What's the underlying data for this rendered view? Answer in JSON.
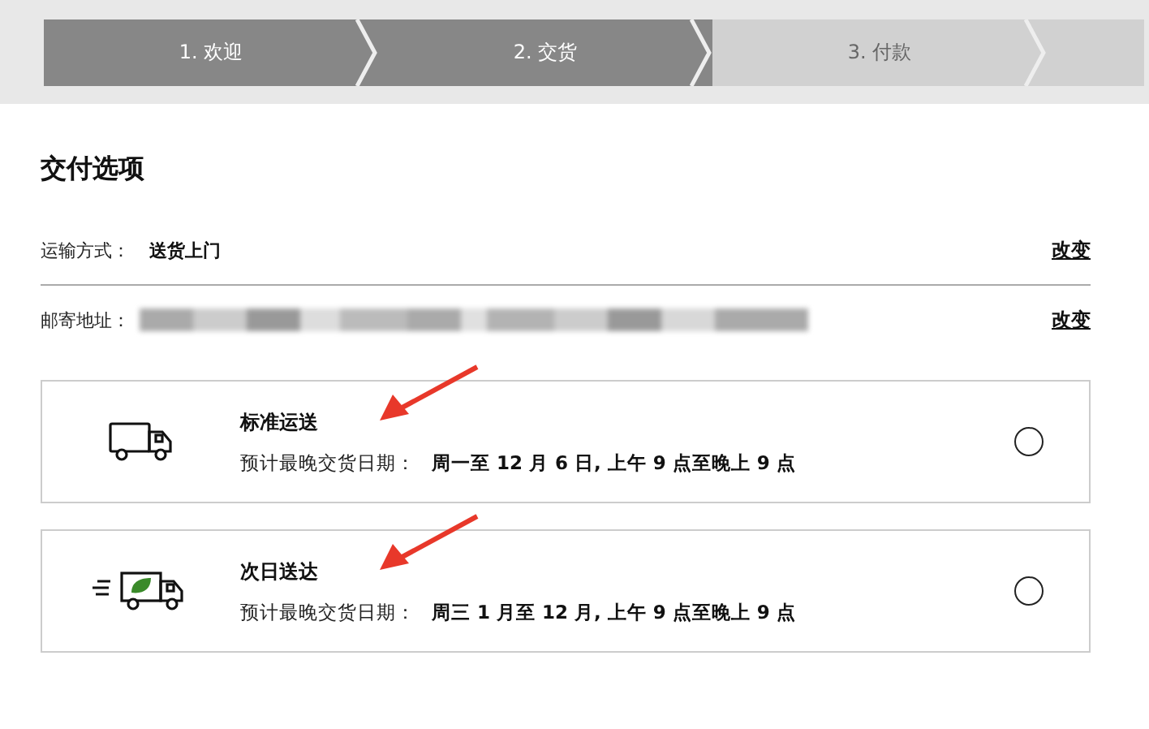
{
  "steps": [
    {
      "label": "1. 欢迎",
      "reached": true
    },
    {
      "label": "2. 交货",
      "reached": true
    },
    {
      "label": "3. 付款",
      "reached": false
    }
  ],
  "title": "交付选项",
  "info_rows": [
    {
      "label": "运输方式：",
      "value": "送货上门",
      "action": "改变"
    },
    {
      "label": "邮寄地址：",
      "action": "改变"
    }
  ],
  "options": [
    {
      "kind": "standard",
      "name": "标准运送",
      "date_label": "预计最晚交货日期：",
      "date": "周一至 12 月 6 日, 上午 9 点至晚上 9 点",
      "selected": false,
      "annotated": true
    },
    {
      "kind": "express",
      "name": "次日送达",
      "date_label": "预计最晚交货日期：",
      "date": "周三 1 月至 12 月, 上午 9 点至晚上 9 点",
      "selected": false,
      "annotated": true
    }
  ]
}
